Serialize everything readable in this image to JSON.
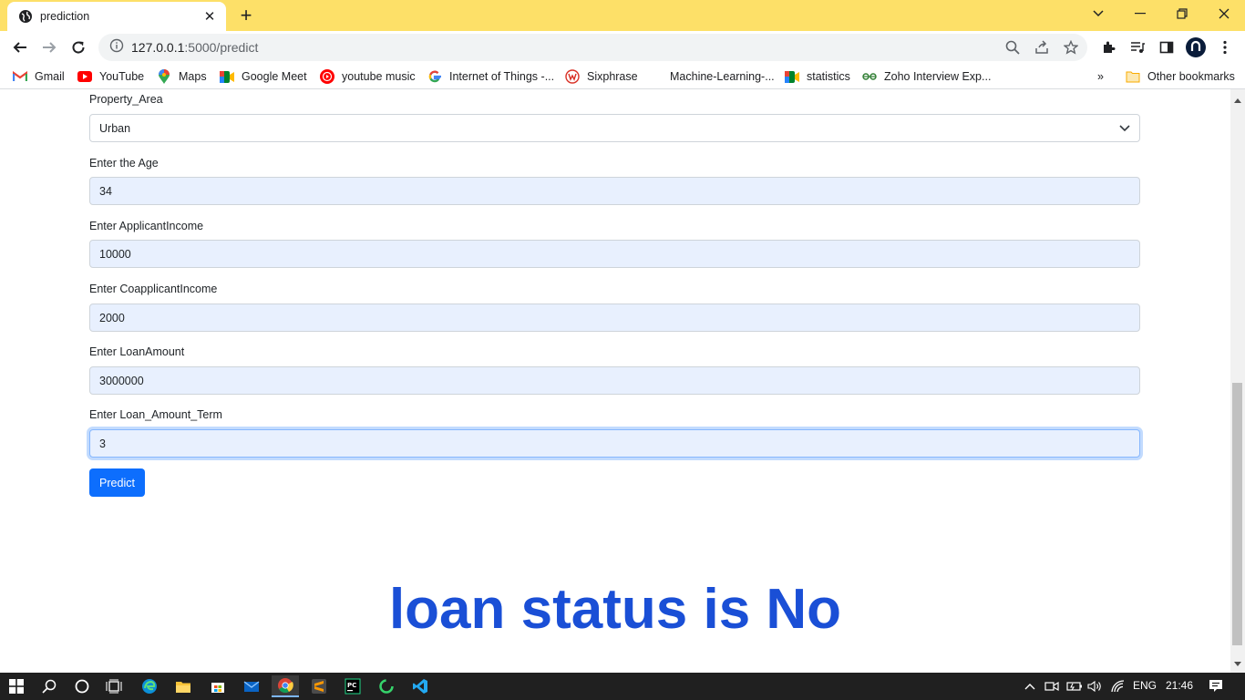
{
  "browser": {
    "tab_title": "prediction",
    "url_host": "127.0.0.1",
    "url_rest": ":5000/predict",
    "bookmarks": [
      {
        "label": "Gmail",
        "icon": "gmail-icon"
      },
      {
        "label": "YouTube",
        "icon": "youtube-icon"
      },
      {
        "label": "Maps",
        "icon": "maps-icon"
      },
      {
        "label": "Google Meet",
        "icon": "meet-icon"
      },
      {
        "label": "youtube music",
        "icon": "youtube-music-icon"
      },
      {
        "label": "Internet of Things -...",
        "icon": "google-icon"
      },
      {
        "label": "Sixphrase",
        "icon": "sixphrase-icon"
      },
      {
        "label": "Machine-Learning-...",
        "icon": "blank-icon"
      },
      {
        "label": "statistics",
        "icon": "meet-icon"
      },
      {
        "label": "Zoho Interview Exp...",
        "icon": "zoho-icon"
      }
    ],
    "overflow_label": "»",
    "other_bookmarks": "Other bookmarks"
  },
  "form": {
    "property_area": {
      "label": "Property_Area",
      "value": "Urban"
    },
    "age": {
      "label": "Enter the Age",
      "value": "34"
    },
    "applicant_income": {
      "label": "Enter ApplicantIncome",
      "value": "10000"
    },
    "coapplicant_income": {
      "label": "Enter CoapplicantIncome",
      "value": "2000"
    },
    "loan_amount": {
      "label": "Enter LoanAmount",
      "value": "3000000"
    },
    "loan_amount_term": {
      "label": "Enter Loan_Amount_Term",
      "value": "3"
    },
    "submit_label": "Predict"
  },
  "result": {
    "text": "loan status is No",
    "color": "#1a4fd6"
  },
  "taskbar": {
    "language": "ENG",
    "time": "21:46"
  },
  "colors": {
    "titlebar": "#fde068",
    "primary_button": "#0d6efd",
    "autofill_bg": "#e8f0fe"
  }
}
